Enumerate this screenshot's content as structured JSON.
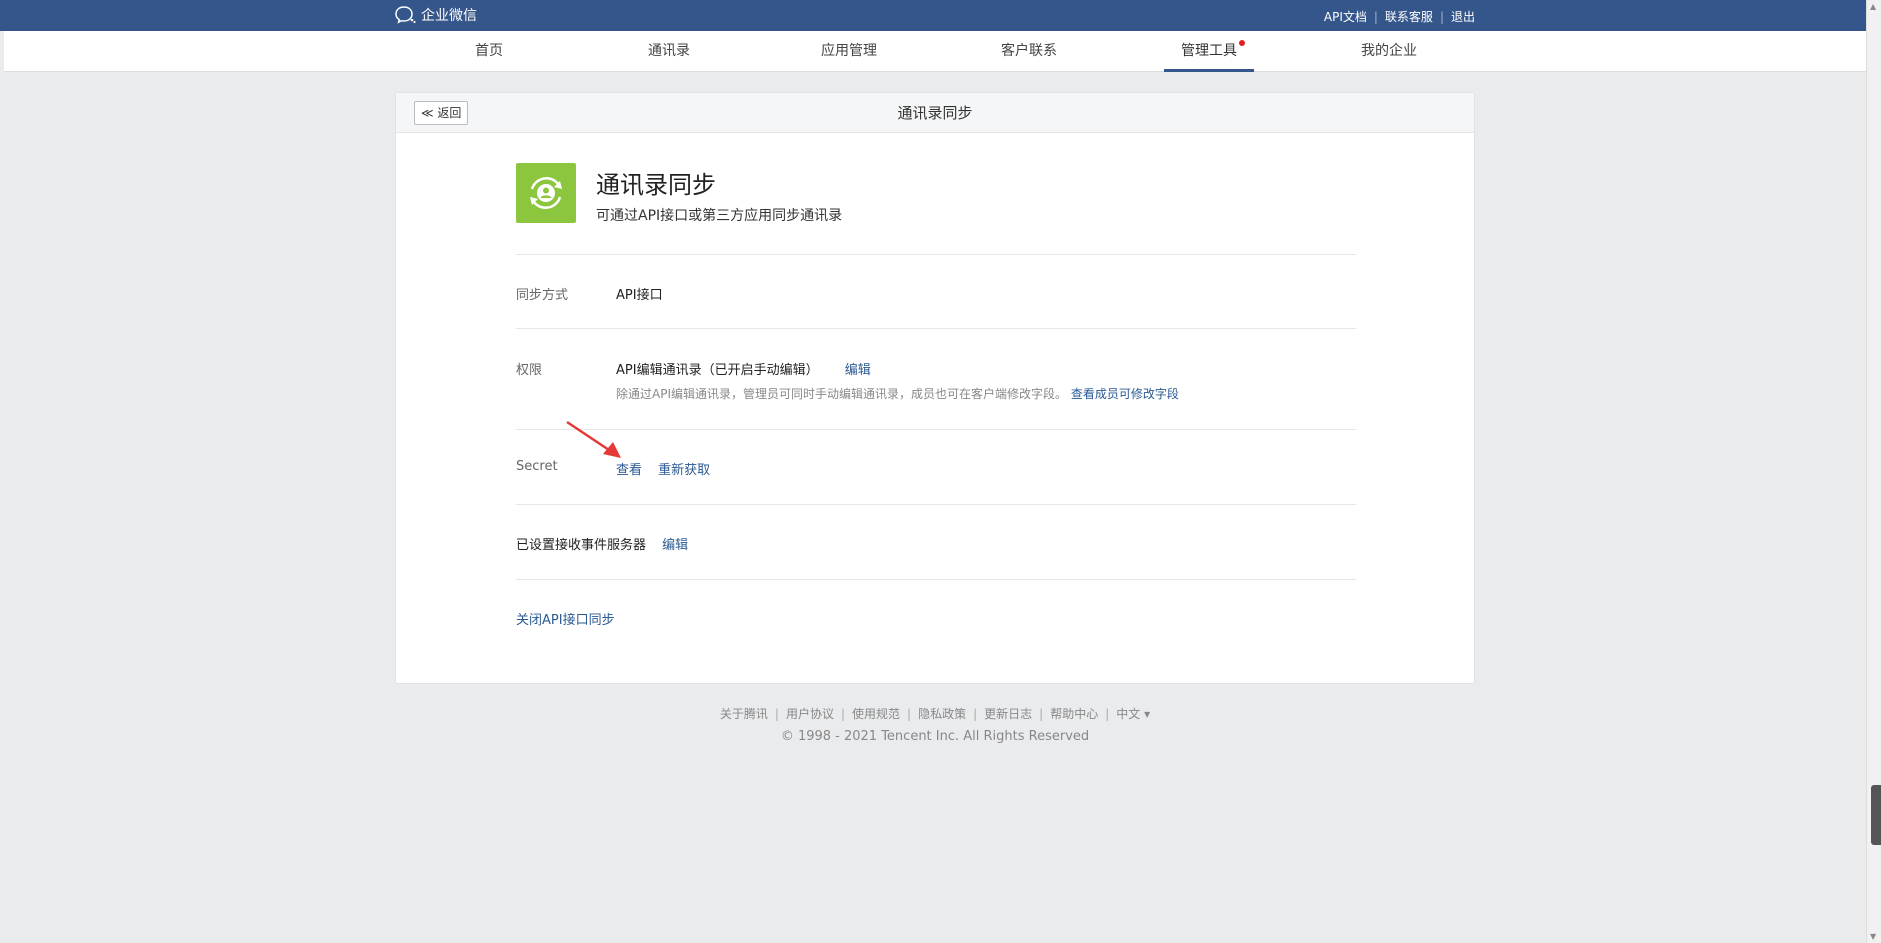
{
  "brand": {
    "name": "企业微信"
  },
  "toplinks": {
    "api_docs": "API文档",
    "support": "联系客服",
    "logout": "退出",
    "sep": "|"
  },
  "nav": {
    "items": [
      {
        "label": "首页"
      },
      {
        "label": "通讯录"
      },
      {
        "label": "应用管理"
      },
      {
        "label": "客户联系"
      },
      {
        "label": "管理工具"
      },
      {
        "label": "我的企业"
      }
    ],
    "active": "管理工具"
  },
  "card": {
    "back_label": "≪ 返回",
    "title": "通讯录同步",
    "app": {
      "name": "通讯录同步",
      "desc": "可通过API接口或第三方应用同步通讯录"
    },
    "rows": {
      "sync_mode": {
        "label": "同步方式",
        "value": "API接口"
      },
      "permission": {
        "label": "权限",
        "value": "API编辑通讯录（已开启手动编辑）",
        "edit": "编辑",
        "hint": "除通过API编辑通讯录，管理员可同时手动编辑通讯录，成员也可在客户端修改字段。",
        "hint_link": "查看成员可修改字段"
      },
      "secret": {
        "label": "Secret",
        "view": "查看",
        "refresh": "重新获取"
      },
      "event_server": {
        "label": "已设置接收事件服务器",
        "edit": "编辑"
      },
      "close_sync": "关闭API接口同步"
    }
  },
  "footer": {
    "links": [
      "关于腾讯",
      "用户协议",
      "使用规范",
      "隐私政策",
      "更新日志",
      "帮助中心",
      "中文 ▾"
    ],
    "sep": "|",
    "copyright": "© 1998 - 2021 Tencent Inc. All Rights Reserved"
  },
  "colors": {
    "header": "#34568b",
    "link": "#2b5a93",
    "app_icon": "#8cc63e",
    "arrow": "#e53935"
  }
}
